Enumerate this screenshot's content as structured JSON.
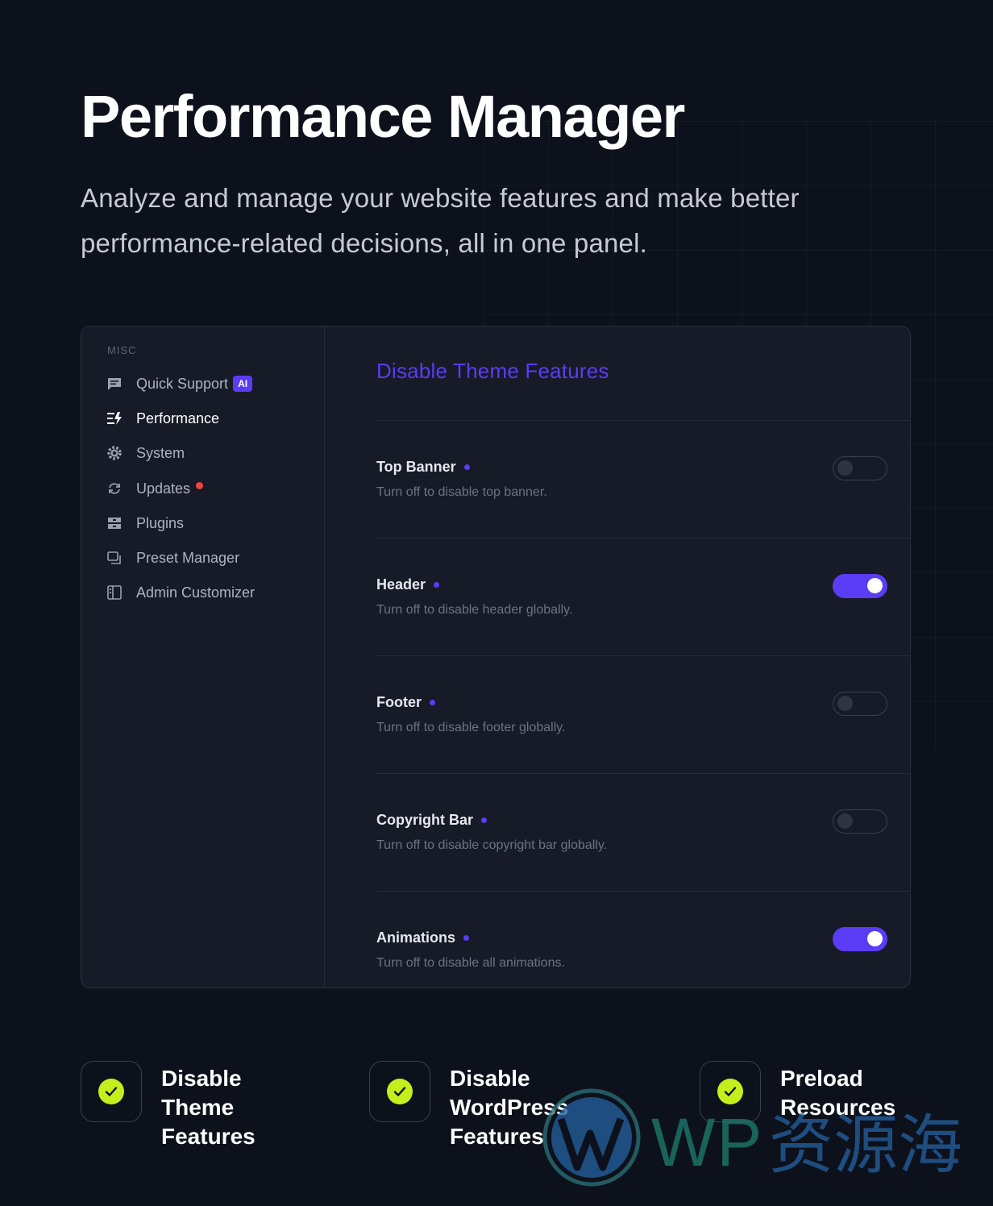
{
  "hero": {
    "title": "Performance Manager",
    "subtitle": "Analyze and manage your website features and make better performance-related decisions, all in one panel."
  },
  "sidebar": {
    "heading": "MISC",
    "items": [
      {
        "label": "Quick Support",
        "icon": "chat-icon",
        "badge": "AI"
      },
      {
        "label": "Performance",
        "icon": "performance-icon",
        "active": true
      },
      {
        "label": "System",
        "icon": "gear-icon"
      },
      {
        "label": "Updates",
        "icon": "refresh-icon",
        "notification": true
      },
      {
        "label": "Plugins",
        "icon": "plugins-icon"
      },
      {
        "label": "Preset Manager",
        "icon": "preset-icon"
      },
      {
        "label": "Admin Customizer",
        "icon": "layout-icon"
      }
    ]
  },
  "main": {
    "title": "Disable Theme Features",
    "rows": [
      {
        "title": "Top Banner",
        "description": "Turn off to disable top banner.",
        "enabled": false
      },
      {
        "title": "Header",
        "description": "Turn off to disable header globally.",
        "enabled": true
      },
      {
        "title": "Footer",
        "description": "Turn off to disable footer globally.",
        "enabled": false
      },
      {
        "title": "Copyright Bar",
        "description": "Turn off to disable copyright bar globally.",
        "enabled": false
      },
      {
        "title": "Animations",
        "description": "Turn off to disable all animations.",
        "enabled": true
      }
    ]
  },
  "features": [
    {
      "label": "Disable Theme\nFeatures"
    },
    {
      "label": "Disable WordPress\nFeatures"
    },
    {
      "label": "Preload\nResources"
    }
  ],
  "watermark": {
    "text": "WP资源海"
  },
  "colors": {
    "background": "#0d111b",
    "panel": "#161b27",
    "accent": "#5b3cf5",
    "check": "#c5ef1c",
    "notification": "#ef4444"
  }
}
